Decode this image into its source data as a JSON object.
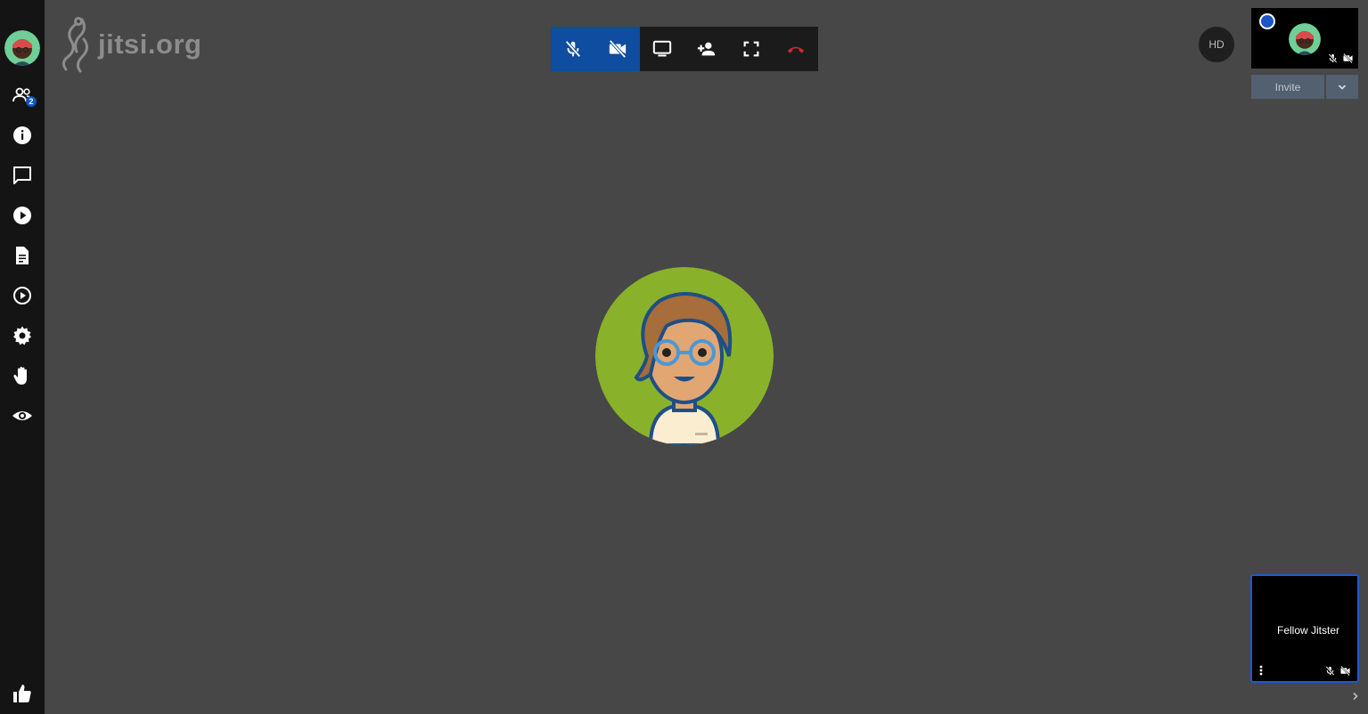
{
  "app": {
    "logo_text": "jitsi.org"
  },
  "sidebar": {
    "participants_badge": "2",
    "items": [
      {
        "name": "participants-icon"
      },
      {
        "name": "info-icon"
      },
      {
        "name": "chat-icon"
      },
      {
        "name": "youtube-play-icon"
      },
      {
        "name": "document-icon"
      },
      {
        "name": "recording-play-icon"
      },
      {
        "name": "settings-gear-icon"
      },
      {
        "name": "raise-hand-icon"
      },
      {
        "name": "tile-view-eye-icon"
      },
      {
        "name": "feedback-thumbs-up-icon"
      }
    ]
  },
  "toolbar": {
    "buttons": [
      "mic-muted",
      "camera-off",
      "screen-share",
      "invite-person",
      "fullscreen",
      "hangup"
    ],
    "active_color": "#0e4da0",
    "hangup_color": "#cc2b2b"
  },
  "video_quality": {
    "label": "HD"
  },
  "local_video": {
    "invite_label": "Invite"
  },
  "remote_participant": {
    "display_name": "Fellow Jitster",
    "highlight_color": "#1c5ad1"
  }
}
